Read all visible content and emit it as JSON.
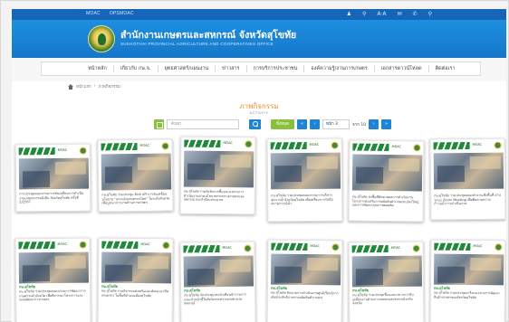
{
  "utilbar": {
    "links": [
      "MOAC",
      "OPSMOAC"
    ],
    "icons": [
      "user-icon",
      "search-icon",
      "font-size-icon",
      "email-icon",
      "phone-icon",
      "location-icon"
    ],
    "icon_glyphs": [
      "♟",
      "⚲",
      "A·A",
      "✉",
      "✆",
      "⚲"
    ]
  },
  "header": {
    "title": "สำนักงานเกษตรและสหกรณ์ จังหวัดสุโขทัย",
    "subtitle": "SUKHOTHAI PROVINCIAL AGRICULTURE AND COOPERATIVES OFFICE"
  },
  "nav": {
    "items": [
      "หน้าหลัก",
      "เกี่ยวกับ กษ.จ.",
      "ยุทธศาสตร์/แผนงาน",
      "ข่าวสาร",
      "การบริการประชาชน",
      "องค์ความรู้/งานการเกษตร",
      "เอกสารดาวน์โหลด",
      "ติดต่อเรา"
    ]
  },
  "breadcrumb": {
    "items": [
      "หน้าแรก",
      "ภาพกิจกรรม"
    ],
    "separator": "›"
  },
  "section": {
    "title": "ภาพกิจกรรม",
    "subtitle": "ACTIVITY"
  },
  "filter": {
    "search_placeholder": "ค้นหา",
    "all_label": "ทั้งหมด",
    "first_label": "«",
    "prev_label": "‹",
    "page_value": "หน้า 3",
    "of_label": "จาก 10",
    "next_label": "›",
    "last_label": "»"
  },
  "colors": {
    "brand_blue": "#1677c9",
    "accent_orange": "#f08a24",
    "accent_green": "#8ac040"
  },
  "cards": [
    {
      "brand": "MOAC",
      "tag": "",
      "text": "การประชุมคณะกรรมการขับเคลื่อนการดำเนินงานเกษตรกรรมยั่งยืน จังหวัดสุโขทัย ครั้งที่ 2/2567"
    },
    {
      "brand": "MOAC",
      "tag": "",
      "text": "กษ.สุโขทัย ร่วมประชุม Kick off การขับเคลื่อนนโยบาย \"ยกระดับเกษตรกรไทย\" ในระดับจังหวัด เพื่อบูรณาการงานด้านการเกษตร"
    },
    {
      "brand": "MOAC",
      "tag": "",
      "text": "กษ.สุโขทัย ร่วมรับฟังการชี้แจงแนวทางการดำเนินงานตามนโยบายกระทรวงเกษตรและสหกรณ์ ประจำปีงบประมาณ"
    },
    {
      "brand": "MOAC",
      "tag": "",
      "text": "กษ.สุโขทัย ร่วมประชุมคณะกรรมการบริหารจัดการน้ำจังหวัดสุโขทัย เพื่อเตรียมการรับมือสถานการณ์น้ำ"
    },
    {
      "brand": "MOAC",
      "tag": "",
      "text": "กษ.สุโขทัย ลงพื้นที่ติดตามผลการดำเนินงานโครงการส่งเสริมการผลิตสินค้าเกษตรแปลงใหญ่ และการพัฒนาคุณภาพผลผลิต"
    },
    {
      "brand": "MOAC",
      "tag": "",
      "text": "กษ.สุโขทัย ร่วมประชุมคณะทำงานเชิงพื้นที่ ผ่านระบบ Zoom Meeting เพื่อติดตามความก้าวหน้าการดำเนินงาน"
    },
    {
      "brand": "MOAC",
      "tag": "กษ.สุโขทัย",
      "text": "กษ.สุโขทัย ร่วมประชุมคณะกรรมการพัฒนาการเกษตรระดับจังหวัด เพื่อพิจารณาโครงการและแผนพัฒนาการเกษตร"
    },
    {
      "brand": "MOAC",
      "tag": "กษ.สุโขทัย",
      "text": "กษ.สุโขทัย ร่วมกิจกรรมส่งเสริมและพัฒนาอาชีพเกษตรกร ในพื้นที่อำเภอเมืองสุโขทัย"
    },
    {
      "brand": "MOAC",
      "tag": "กษ.สุโขทัย",
      "text": "กษ.สุโขทัย จัดประชุมประจำเดือนข้าราชการและเจ้าหน้าที่ในสังกัดกระทรวงเกษตรและสหกรณ์"
    },
    {
      "brand": "MOAC",
      "tag": "กษ.สุโขทัย",
      "text": "กษ.สุโขทัย ติดตามการดำเนินงานศูนย์เรียนรู้การเพิ่มประสิทธิภาพการผลิตสินค้าเกษตร"
    },
    {
      "brand": "MOAC",
      "tag": "กษ.สุโขทัย",
      "text": "กษ.สุโขทัย ร่วมประชุมชี้แจงแนวทางการขับเคลื่อนงานด้านการเกษตรและสหกรณ์ระดับจังหวัด"
    },
    {
      "brand": "MOAC",
      "tag": "กษ.สุโขทัย",
      "text": "กษ.สุโขทัย ร่วมประชุมหารือแนวทางการพัฒนาสินค้าเกษตรของจังหวัดสุโขทัย"
    }
  ]
}
